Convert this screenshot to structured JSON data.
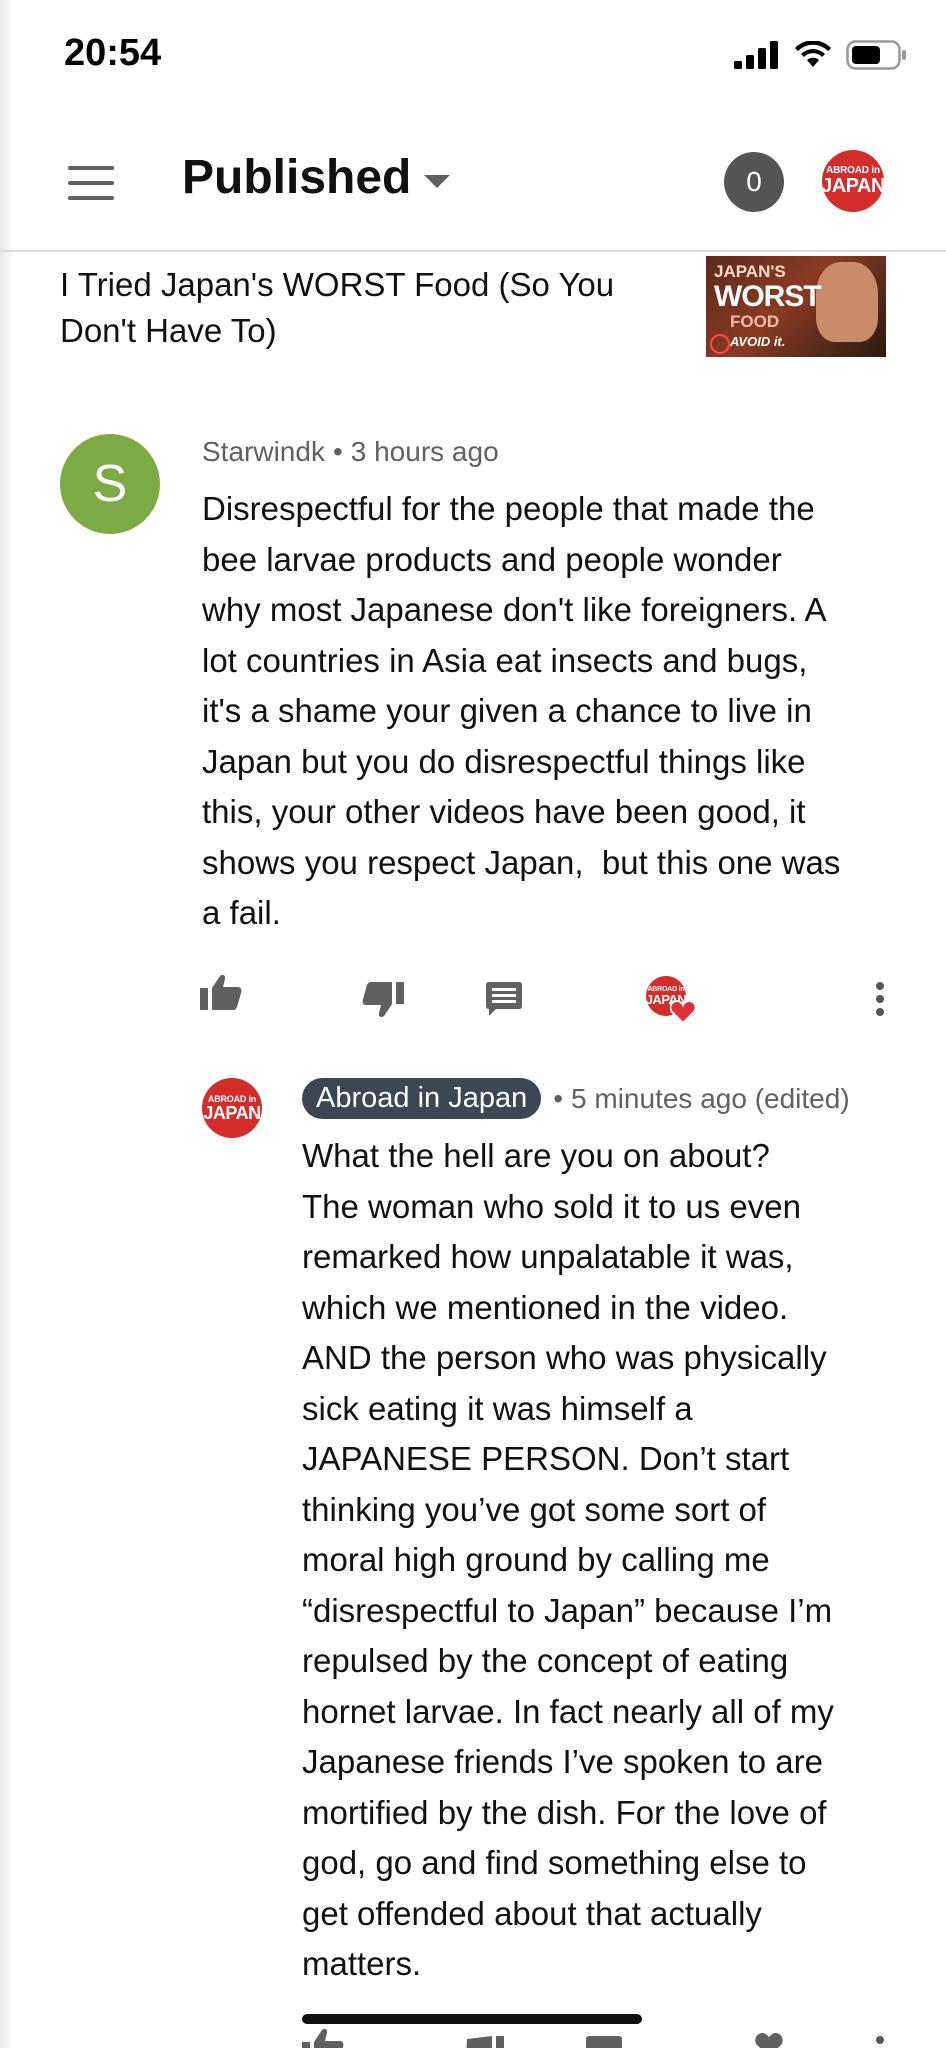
{
  "status_bar": {
    "time": "20:54"
  },
  "header": {
    "title": "Published",
    "notification_count": "0",
    "channel_logo": {
      "line1": "ABROAD in",
      "line2": "JAPAN"
    }
  },
  "video": {
    "title": "I Tried Japan's WORST Food (So You Don't Have To)",
    "thumbnail_text": {
      "line1": "JAPAN'S",
      "line2": "WORST",
      "line3": "FOOD",
      "line4": "AVOID it."
    }
  },
  "comment": {
    "avatar_letter": "S",
    "author": "Starwindk",
    "separator": "•",
    "time": "3 hours ago",
    "text": "Disrespectful for the people that made the\nbee larvae products and people wonder\nwhy most Japanese don't like foreigners. A\nlot countries in Asia eat insects and bugs,\nit's a shame your given a chance to live in\nJapan but you do disrespectful things like\nthis, your other videos have been good, it\nshows you respect Japan,  but this one was\na fail."
  },
  "reply": {
    "author": "Abroad in Japan",
    "separator": "•",
    "time": "5 minutes ago (edited)",
    "text": "What the hell are you on about?\nThe woman who sold it to us even\nremarked how unpalatable it was,\nwhich we mentioned in the video.\nAND the person who was physically\nsick eating it was himself a\nJAPANESE PERSON. Don’t start\nthinking you’ve got some sort of\nmoral high ground by calling me\n“disrespectful to Japan” because I’m\nrepulsed by the concept of eating\nhornet larvae. In fact nearly all of my\nJapanese friends I’ve spoken to are\nmortified by the dish. For the love of\ngod, go and find something else to\nget offended about that actually\nmatters."
  },
  "colors": {
    "accent_red": "#d42b2b",
    "avatar_green": "#7cab45",
    "chip_bg": "#3f4653",
    "icon_gray": "#606060"
  },
  "icons": [
    "menu-icon",
    "dropdown-arrow-icon",
    "signal-icon",
    "wifi-icon",
    "battery-icon",
    "like-icon",
    "dislike-icon",
    "reply-icon",
    "creator-heart-icon",
    "more-vert-icon"
  ]
}
